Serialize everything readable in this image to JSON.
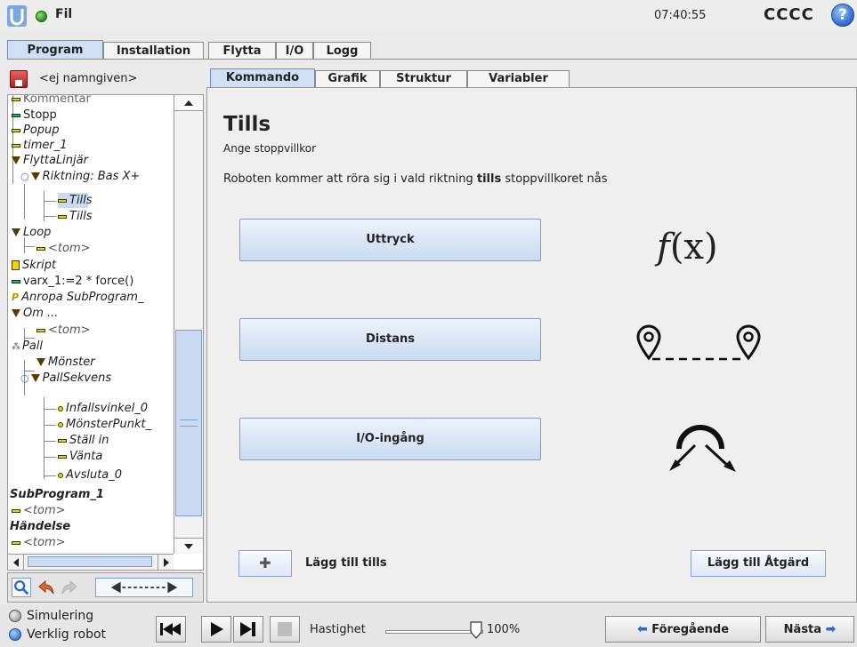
{
  "topbar": {
    "file_label": "Fil",
    "clock": "07:40:55",
    "robot_name": "CCCC",
    "help_glyph": "?"
  },
  "main_tabs": [
    "Program",
    "Installation",
    "Flytta",
    "I/O",
    "Logg"
  ],
  "program_name": "<ej namngiven>",
  "tree": [
    {
      "label": "Kommentar",
      "icon": "bar-icon"
    },
    {
      "label": "Stopp",
      "icon": "green-bar-icon"
    },
    {
      "label": "Popup",
      "icon": "bar-icon"
    },
    {
      "label": "timer_1",
      "icon": "bar-icon"
    },
    {
      "label": "FlyttaLinjär",
      "icon": "triangle-icon"
    },
    {
      "label": "Riktning: Bas X+",
      "icon": "triangle-icon"
    },
    {
      "label": "Tills",
      "icon": "bar-icon",
      "selected": true
    },
    {
      "label": "Tills",
      "icon": "bar-icon"
    },
    {
      "label": "Loop",
      "icon": "triangle-icon"
    },
    {
      "label": "<tom>",
      "icon": "bar-icon"
    },
    {
      "label": "Skript",
      "icon": "script-icon"
    },
    {
      "label": "varx_1:=2 * force()",
      "icon": "green-bar-icon"
    },
    {
      "label": "Anropa SubProgram_",
      "icon": "call-icon"
    },
    {
      "label": "Om ...",
      "icon": "triangle-icon"
    },
    {
      "label": "<tom>",
      "icon": "bar-icon"
    },
    {
      "label": "Pall",
      "icon": "pallet-icon"
    },
    {
      "label": "Mönster",
      "icon": "triangle-icon"
    },
    {
      "label": "PallSekvens",
      "icon": "triangle-icon"
    },
    {
      "label": "Infallsvinkel_0",
      "icon": "dot-icon"
    },
    {
      "label": "MönsterPunkt_",
      "icon": "dot-icon"
    },
    {
      "label": "Ställ in",
      "icon": "bar-icon"
    },
    {
      "label": "Vänta",
      "icon": "bar-icon"
    },
    {
      "label": "Avsluta_0",
      "icon": "dot-icon"
    },
    {
      "label": "SubProgram_1",
      "icon": "none"
    },
    {
      "label": "<tom>",
      "icon": "bar-icon"
    },
    {
      "label": "Händelse",
      "icon": "none"
    },
    {
      "label": "<tom>",
      "icon": "bar-icon"
    }
  ],
  "sub_tabs": [
    "Kommando",
    "Grafik",
    "Struktur",
    "Variabler"
  ],
  "node": {
    "title": "Tills",
    "subtitle": "Ange stoppvillkor",
    "desc_before": "Roboten kommer att röra sig i vald riktning ",
    "desc_bold": "tills",
    "desc_after": " stoppvillkoret nås"
  },
  "options": {
    "expression": "Uttryck",
    "expression_icon_f": "f",
    "expression_icon_rest": "(x)",
    "distance": "Distans",
    "io_input": "I/O-ingång"
  },
  "add_until": {
    "glyph": "✚",
    "label": "Lägg till tills"
  },
  "add_action": "Lägg till Åtgärd",
  "footer": {
    "simulation": "Simulering",
    "real_robot": "Verklig robot",
    "speed_label": "Hastighet",
    "speed_value": "100%",
    "speed_fraction": 1.0,
    "prev": "Föregående",
    "next": "Nästa"
  },
  "colors": {
    "accent": "#2c68c6",
    "selected": "#c9daf2",
    "active_tab": "#cfe0f6"
  }
}
